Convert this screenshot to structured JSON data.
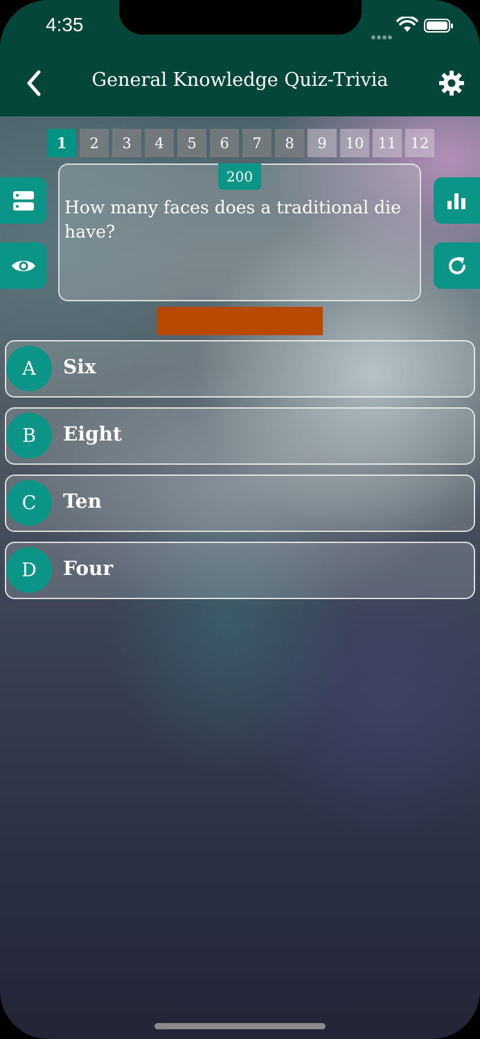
{
  "status_bar": {
    "time": "4:35"
  },
  "header": {
    "title": "General Knowledge Quiz-Trivia"
  },
  "question_numbers": [
    "1",
    "2",
    "3",
    "4",
    "5",
    "6",
    "7",
    "8",
    "9",
    "10",
    "11",
    "12"
  ],
  "current_question": 1,
  "question": {
    "points": "200",
    "text": "How many faces does a traditional die have?"
  },
  "answers": [
    {
      "letter": "A",
      "text": "Six"
    },
    {
      "letter": "B",
      "text": "Eight"
    },
    {
      "letter": "C",
      "text": "Ten"
    },
    {
      "letter": "D",
      "text": "Four"
    }
  ],
  "colors": {
    "header": "#04463a",
    "accent": "#0a9586",
    "timer": "#b84a00"
  },
  "icons": {
    "back": "chevron-left-icon",
    "settings": "gear-icon",
    "left_top": "list-icon",
    "left_bottom": "eye-icon",
    "right_top": "bar-chart-icon",
    "right_bottom": "refresh-icon"
  }
}
